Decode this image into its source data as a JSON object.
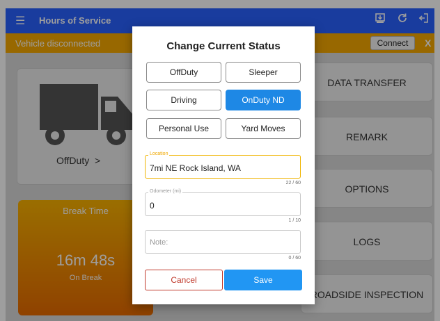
{
  "app": {
    "title": "Hours of Service",
    "menu_icon": "hamburger-icon",
    "actions": [
      "transfer-icon",
      "refresh-icon",
      "logout-icon"
    ]
  },
  "banner": {
    "message": "Vehicle disconnected",
    "connect_label": "Connect",
    "dismiss_label": "X"
  },
  "status_card": {
    "label": "OffDuty",
    "chevron": ">",
    "icon": "truck-icon"
  },
  "break_card": {
    "title": "Break Time",
    "time": "16m 48s",
    "subtitle": "On Break"
  },
  "side_buttons": [
    "DATA TRANSFER",
    "REMARK",
    "OPTIONS",
    "LOGS",
    "ROADSIDE INSPECTION"
  ],
  "dialog": {
    "title": "Change Current Status",
    "statuses": [
      {
        "label": "OffDuty",
        "selected": false
      },
      {
        "label": "Sleeper",
        "selected": false
      },
      {
        "label": "Driving",
        "selected": false
      },
      {
        "label": "OnDuty ND",
        "selected": true
      },
      {
        "label": "Personal Use",
        "selected": false
      },
      {
        "label": "Yard Moves",
        "selected": false
      }
    ],
    "location": {
      "label": "Location",
      "value": "7mi NE Rock Island, WA",
      "counter": "22 / 60"
    },
    "odometer": {
      "label": "Odometer (mi)",
      "value": "0",
      "counter": "1 / 10"
    },
    "note": {
      "placeholder": "Note:",
      "counter": "0 / 60"
    },
    "cancel_label": "Cancel",
    "save_label": "Save"
  },
  "colors": {
    "appbar": "#2962ff",
    "banner": "#f6a800",
    "selected": "#1e88e5",
    "save": "#2196f3",
    "cancel": "#c0392b",
    "focus": "#f0b400"
  }
}
